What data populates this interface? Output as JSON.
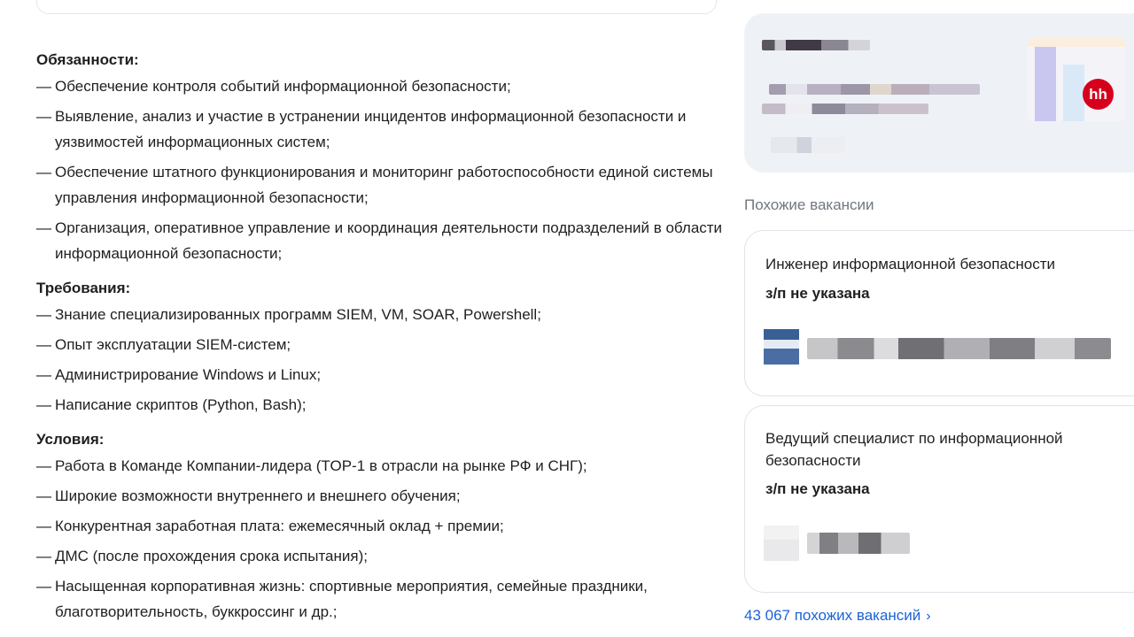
{
  "description": {
    "sections": [
      {
        "title": "Обязанности:",
        "items": [
          "Обеспечение контроля событий информационной безопасности;",
          "Выявление, анализ и участие в устранении инцидентов информационной безопасности и уязвимостей информационных систем;",
          "Обеспечение штатного функционирования и мониторинг работоспособности единой системы управления информационной безопасности;",
          "Организация, оперативное управление и координация деятельности подразделений в области информационной безопасности;"
        ]
      },
      {
        "title": "Требования:",
        "items": [
          "Знание специализированных программ SIEM, VM, SOAR, Powershell;",
          "Опыт эксплуатации SIEM-систем;",
          "Администрирование Windows и Linux;",
          "Написание скриптов (Python, Bash);"
        ]
      },
      {
        "title": "Условия:",
        "items": [
          "Работа в Команде Компании-лидера (TOP-1 в отрасли на рынке РФ и СНГ);",
          "Широкие возможности внутреннего и внешнего обучения;",
          "Конкурентная заработная плата: ежемесячный оклад + премии;",
          "ДМС (после прохождения срока испытания);",
          "Насыщенная корпоративная жизнь: спортивные мероприятия, семейные праздники, благотворительность, буккроссинг и др.;"
        ]
      }
    ],
    "dash": "—"
  },
  "sidebar": {
    "employer_badge": "hh",
    "similar_title": "Похожие вакансии",
    "vacancies": [
      {
        "title": "Инженер информационной безопасности",
        "salary": "з/п не указана"
      },
      {
        "title": "Ведущий специалист по информационной безопасности",
        "salary": "з/п не указана"
      }
    ],
    "more_link": "43 067 похожих вакансий",
    "chevron_icon": "chevron-right-icon"
  },
  "colors": {
    "link": "#1a64d6",
    "badge": "#d6001c",
    "card_bg": "#eef2f7"
  }
}
